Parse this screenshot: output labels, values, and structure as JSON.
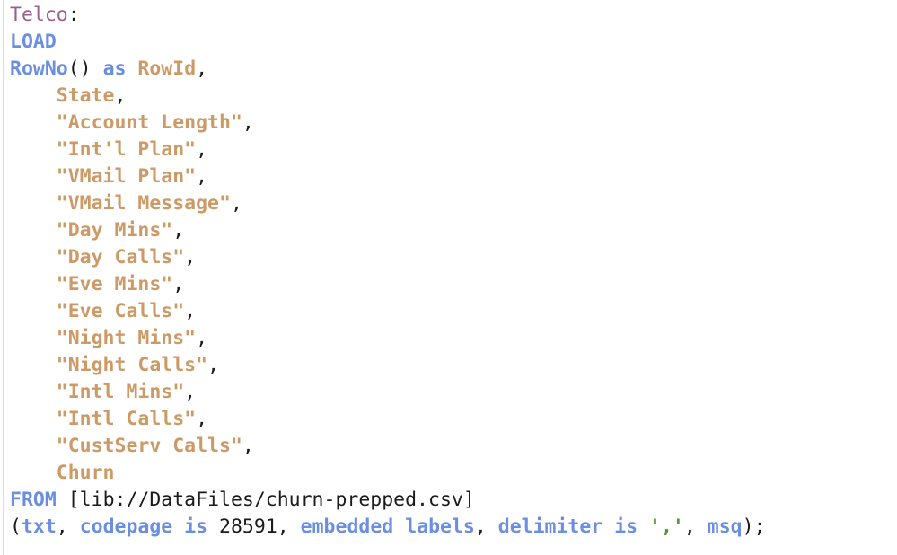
{
  "editor": {
    "language": "qlik-load-script",
    "background_color": "#ffffff",
    "gutter_color": "#dcdcdc",
    "colors": {
      "label": "#9b5f8e",
      "keyword": "#6b8fe0",
      "field": "#cc9a66",
      "string": "#4f9a2e",
      "punctuation": "#1a1a1a",
      "number": "#1a1a1a"
    },
    "lines": [
      {
        "n": 1,
        "indent": 0,
        "text": "Telco:",
        "tokens": [
          {
            "t": "Telco",
            "k": "label"
          },
          {
            "t": ":",
            "k": "punct"
          }
        ]
      },
      {
        "n": 2,
        "indent": 0,
        "text": "LOAD",
        "tokens": [
          {
            "t": "LOAD",
            "k": "keyword"
          }
        ]
      },
      {
        "n": 3,
        "indent": 0,
        "text": "RowNo() as RowId,",
        "tokens": [
          {
            "t": "RowNo",
            "k": "func"
          },
          {
            "t": "()",
            "k": "punct"
          },
          {
            "t": " ",
            "k": "punct"
          },
          {
            "t": "as",
            "k": "keyword"
          },
          {
            "t": " ",
            "k": "punct"
          },
          {
            "t": "RowId",
            "k": "field"
          },
          {
            "t": ",",
            "k": "punct"
          }
        ]
      },
      {
        "n": 4,
        "indent": 4,
        "text": "    State,",
        "tokens": [
          {
            "t": "    ",
            "k": "punct"
          },
          {
            "t": "State",
            "k": "field"
          },
          {
            "t": ",",
            "k": "punct"
          }
        ]
      },
      {
        "n": 5,
        "indent": 4,
        "text": "    \"Account Length\",",
        "tokens": [
          {
            "t": "    ",
            "k": "punct"
          },
          {
            "t": "\"Account Length\"",
            "k": "field"
          },
          {
            "t": ",",
            "k": "punct"
          }
        ]
      },
      {
        "n": 6,
        "indent": 4,
        "text": "    \"Int'l Plan\",",
        "tokens": [
          {
            "t": "    ",
            "k": "punct"
          },
          {
            "t": "\"Int'l Plan\"",
            "k": "field"
          },
          {
            "t": ",",
            "k": "punct"
          }
        ]
      },
      {
        "n": 7,
        "indent": 4,
        "text": "    \"VMail Plan\",",
        "tokens": [
          {
            "t": "    ",
            "k": "punct"
          },
          {
            "t": "\"VMail Plan\"",
            "k": "field"
          },
          {
            "t": ",",
            "k": "punct"
          }
        ]
      },
      {
        "n": 8,
        "indent": 4,
        "text": "    \"VMail Message\",",
        "tokens": [
          {
            "t": "    ",
            "k": "punct"
          },
          {
            "t": "\"VMail Message\"",
            "k": "field"
          },
          {
            "t": ",",
            "k": "punct"
          }
        ]
      },
      {
        "n": 9,
        "indent": 4,
        "text": "    \"Day Mins\",",
        "tokens": [
          {
            "t": "    ",
            "k": "punct"
          },
          {
            "t": "\"Day Mins\"",
            "k": "field"
          },
          {
            "t": ",",
            "k": "punct"
          }
        ]
      },
      {
        "n": 10,
        "indent": 4,
        "text": "    \"Day Calls\",",
        "tokens": [
          {
            "t": "    ",
            "k": "punct"
          },
          {
            "t": "\"Day Calls\"",
            "k": "field"
          },
          {
            "t": ",",
            "k": "punct"
          }
        ]
      },
      {
        "n": 11,
        "indent": 4,
        "text": "    \"Eve Mins\",",
        "tokens": [
          {
            "t": "    ",
            "k": "punct"
          },
          {
            "t": "\"Eve Mins\"",
            "k": "field"
          },
          {
            "t": ",",
            "k": "punct"
          }
        ]
      },
      {
        "n": 12,
        "indent": 4,
        "text": "    \"Eve Calls\",",
        "tokens": [
          {
            "t": "    ",
            "k": "punct"
          },
          {
            "t": "\"Eve Calls\"",
            "k": "field"
          },
          {
            "t": ",",
            "k": "punct"
          }
        ]
      },
      {
        "n": 13,
        "indent": 4,
        "text": "    \"Night Mins\",",
        "tokens": [
          {
            "t": "    ",
            "k": "punct"
          },
          {
            "t": "\"Night Mins\"",
            "k": "field"
          },
          {
            "t": ",",
            "k": "punct"
          }
        ]
      },
      {
        "n": 14,
        "indent": 4,
        "text": "    \"Night Calls\",",
        "tokens": [
          {
            "t": "    ",
            "k": "punct"
          },
          {
            "t": "\"Night Calls\"",
            "k": "field"
          },
          {
            "t": ",",
            "k": "punct"
          }
        ]
      },
      {
        "n": 15,
        "indent": 4,
        "text": "    \"Intl Mins\",",
        "tokens": [
          {
            "t": "    ",
            "k": "punct"
          },
          {
            "t": "\"Intl Mins\"",
            "k": "field"
          },
          {
            "t": ",",
            "k": "punct"
          }
        ]
      },
      {
        "n": 16,
        "indent": 4,
        "text": "    \"Intl Calls\",",
        "tokens": [
          {
            "t": "    ",
            "k": "punct"
          },
          {
            "t": "\"Intl Calls\"",
            "k": "field"
          },
          {
            "t": ",",
            "k": "punct"
          }
        ]
      },
      {
        "n": 17,
        "indent": 4,
        "text": "    \"CustServ Calls\",",
        "tokens": [
          {
            "t": "    ",
            "k": "punct"
          },
          {
            "t": "\"CustServ Calls\"",
            "k": "field"
          },
          {
            "t": ",",
            "k": "punct"
          }
        ]
      },
      {
        "n": 18,
        "indent": 4,
        "text": "    Churn",
        "tokens": [
          {
            "t": "    ",
            "k": "punct"
          },
          {
            "t": "Churn",
            "k": "field"
          }
        ]
      },
      {
        "n": 19,
        "indent": 0,
        "text": "FROM [lib://DataFiles/churn-prepped.csv]",
        "tokens": [
          {
            "t": "FROM",
            "k": "keyword"
          },
          {
            "t": " ",
            "k": "punct"
          },
          {
            "t": "[lib://DataFiles/churn-prepped.csv]",
            "k": "path"
          }
        ]
      },
      {
        "n": 20,
        "indent": 0,
        "text": "(txt, codepage is 28591, embedded labels, delimiter is ',', msq);",
        "tokens": [
          {
            "t": "(",
            "k": "punct"
          },
          {
            "t": "txt",
            "k": "keyword"
          },
          {
            "t": ", ",
            "k": "punct"
          },
          {
            "t": "codepage",
            "k": "keyword"
          },
          {
            "t": " ",
            "k": "punct"
          },
          {
            "t": "is",
            "k": "keyword"
          },
          {
            "t": " ",
            "k": "punct"
          },
          {
            "t": "28591",
            "k": "number"
          },
          {
            "t": ", ",
            "k": "punct"
          },
          {
            "t": "embedded",
            "k": "keyword"
          },
          {
            "t": " ",
            "k": "punct"
          },
          {
            "t": "labels",
            "k": "keyword"
          },
          {
            "t": ", ",
            "k": "punct"
          },
          {
            "t": "delimiter",
            "k": "keyword"
          },
          {
            "t": " ",
            "k": "punct"
          },
          {
            "t": "is",
            "k": "keyword"
          },
          {
            "t": " ",
            "k": "punct"
          },
          {
            "t": "','",
            "k": "string"
          },
          {
            "t": ", ",
            "k": "punct"
          },
          {
            "t": "msq",
            "k": "keyword"
          },
          {
            "t": ");",
            "k": "punct"
          }
        ]
      }
    ]
  }
}
